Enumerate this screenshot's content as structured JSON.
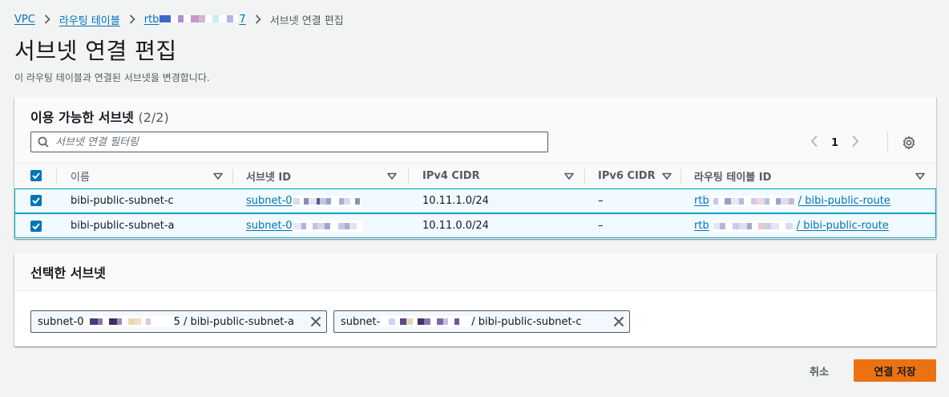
{
  "breadcrumb": {
    "vpc": "VPC",
    "route_tables": "라우팅 테이블",
    "rtb_prefix": "rtb",
    "rtb_suffix": "7",
    "current": "서브넷 연결 편집"
  },
  "page": {
    "title": "서브넷 연결 편집",
    "description": "이 라우팅 테이블과 연결된 서브넷을 변경합니다."
  },
  "available": {
    "title": "이용 가능한 서브넷",
    "count": "(2/2)",
    "search_placeholder": "서브넷 연결 필터링",
    "page_number": "1",
    "columns": [
      "이름",
      "서브넷 ID",
      "IPv4 CIDR",
      "IPv6 CIDR",
      "라우팅 테이블 ID"
    ],
    "rows": [
      {
        "name": "bibi-public-subnet-c",
        "subnet_id_prefix": "subnet-0",
        "ipv4": "10.11.1.0/24",
        "ipv6": "–",
        "route_prefix": "rtb",
        "route_suffix": "/ bibi-public-route",
        "checked": true
      },
      {
        "name": "bibi-public-subnet-a",
        "subnet_id_prefix": "subnet-0",
        "ipv4": "10.11.0.0/24",
        "ipv6": "–",
        "route_prefix": "rtb",
        "route_suffix": "/ bibi-public-route",
        "checked": true
      }
    ]
  },
  "selected": {
    "title": "선택한 서브넷",
    "tokens": [
      {
        "prefix": "subnet-0",
        "suffix": "5 / bibi-public-subnet-a"
      },
      {
        "prefix": "subnet-",
        "suffix": "/ bibi-public-subnet-c"
      }
    ]
  },
  "actions": {
    "cancel": "취소",
    "save": "연결 저장"
  },
  "colors": {
    "link": "#0073bb",
    "primary": "#ec7211",
    "selected_row_bg": "#f1faff",
    "selected_row_border": "#00a1c9"
  }
}
